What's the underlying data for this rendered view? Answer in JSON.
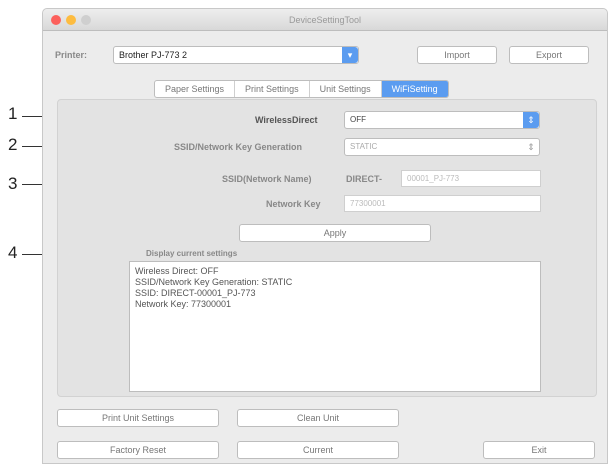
{
  "window": {
    "title": "DeviceSettingTool",
    "traffic_colors": [
      "#fc605c",
      "#fdbc40",
      "#cfcfcf"
    ]
  },
  "printer": {
    "label": "Printer:",
    "value": "Brother PJ-773 2",
    "import_label": "Import",
    "export_label": "Export"
  },
  "tabs": [
    {
      "label": "Paper Settings",
      "active": false
    },
    {
      "label": "Print Settings",
      "active": false
    },
    {
      "label": "Unit Settings",
      "active": false
    },
    {
      "label": "WiFiSetting",
      "active": true
    }
  ],
  "callouts": [
    "1",
    "2",
    "3",
    "4"
  ],
  "wifi": {
    "wireless_direct_label": "WirelessDirect",
    "wireless_direct_value": "OFF",
    "ssid_key_gen_label": "SSID/Network Key Generation",
    "ssid_key_gen_value": "STATIC",
    "ssid_label": "SSID(Network Name)",
    "ssid_prefix": "DIRECT-",
    "ssid_value": "00001_PJ-773",
    "network_key_label": "Network Key",
    "network_key_value": "77300001",
    "apply_label": "Apply"
  },
  "display": {
    "label": "Display current settings",
    "lines": [
      "Wireless Direct: OFF",
      "SSID/Network Key Generation: STATIC",
      "SSID: DIRECT-00001_PJ-773",
      "Network Key: 77300001"
    ]
  },
  "footer": {
    "print_unit_settings": "Print Unit Settings",
    "clean_unit": "Clean Unit",
    "factory_reset": "Factory Reset",
    "current": "Current",
    "exit": "Exit"
  },
  "colors": {
    "accent": "#5b9cf0"
  }
}
